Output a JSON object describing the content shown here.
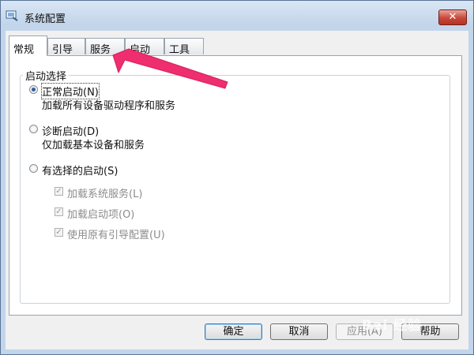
{
  "window": {
    "title": "系统配置",
    "close_label": "✕"
  },
  "tabs": [
    {
      "label": "常规",
      "active": true
    },
    {
      "label": "引导"
    },
    {
      "label": "服务"
    },
    {
      "label": "启动"
    },
    {
      "label": "工具"
    }
  ],
  "startup": {
    "legend": "启动选择",
    "normal": {
      "label": "正常启动(N)",
      "desc": "加载所有设备驱动程序和服务",
      "selected": true
    },
    "diagnostic": {
      "label": "诊断启动(D)",
      "desc": "仅加载基本设备和服务"
    },
    "selective": {
      "label": "有选择的启动(S)",
      "options": [
        {
          "label": "加载系统服务(L)",
          "checked": true
        },
        {
          "label": "加载启动项(O)",
          "checked": true
        },
        {
          "label": "使用原有引导配置(U)",
          "checked": true
        }
      ]
    }
  },
  "buttons": {
    "ok": "确定",
    "cancel": "取消",
    "apply": "应用(A)",
    "help": "帮助"
  },
  "watermark": "Bai 经验",
  "colors": {
    "arrow": "#ee2e6e",
    "close_button": "#c7483a"
  }
}
